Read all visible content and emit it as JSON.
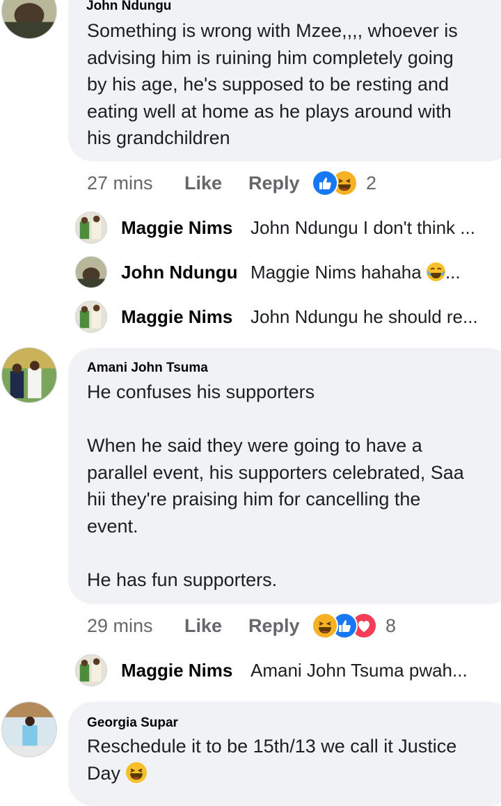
{
  "comments": [
    {
      "author": "John Ndungu",
      "lines": [
        "Something is wrong with Mzee,,,, whoever is",
        "advising him is ruining him completely going",
        "by his age, he's supposed to be resting and",
        "eating well at home as he plays around with",
        "his grandchildren"
      ],
      "time": "27 mins",
      "like_label": "Like",
      "reply_label": "Reply",
      "reaction_count": "2",
      "reactions": [
        "like-icon",
        "haha-icon"
      ],
      "replies": [
        {
          "name": "Maggie Nims",
          "text": "John Ndungu I don't think ..."
        },
        {
          "name": "John Ndungu",
          "text": "Maggie Nims hahaha",
          "suffix": "..."
        },
        {
          "name": "Maggie Nims",
          "text": "John Ndungu he should re..."
        }
      ]
    },
    {
      "author": "Amani John Tsuma",
      "lines": [
        "He confuses his supporters",
        "",
        "When he said they were going to have a",
        "parallel event, his supporters celebrated, Saa",
        "hii they're praising him for cancelling the",
        "event.",
        "",
        "He has fun supporters."
      ],
      "time": "29 mins",
      "like_label": "Like",
      "reply_label": "Reply",
      "reaction_count": "8",
      "reactions": [
        "haha-icon",
        "like-icon",
        "love-icon"
      ],
      "replies": [
        {
          "name": "Maggie Nims",
          "text": "Amani John Tsuma pwah..."
        }
      ]
    },
    {
      "author": "Georgia Supar",
      "lines": [
        "Reschedule it to be 15th/13 we call it Justice",
        "Day"
      ]
    }
  ],
  "colors": {
    "bubble": "#f0f2f5",
    "meta_text": "#65676b",
    "like_blue": "#1877f2",
    "haha_yellow": "#f7b125",
    "love_red": "#f33e58"
  }
}
